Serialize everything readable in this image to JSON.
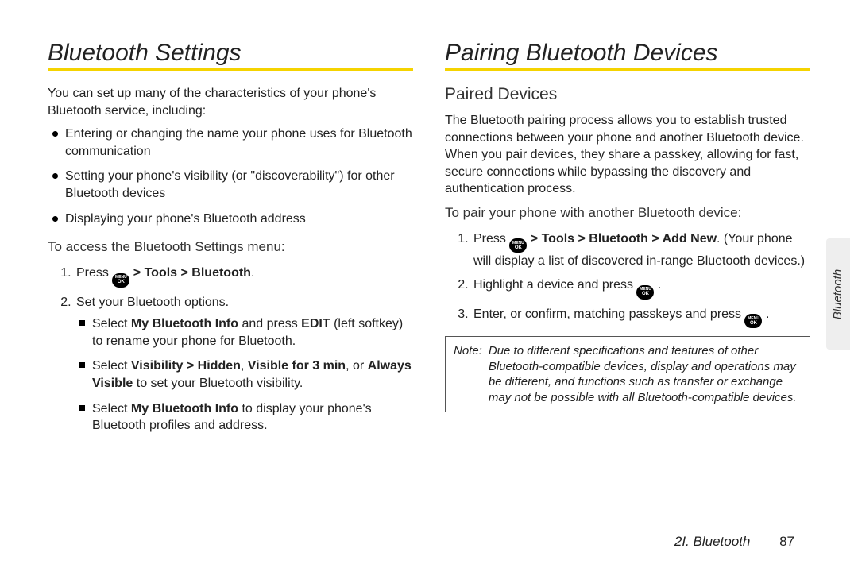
{
  "left": {
    "title": "Bluetooth Settings",
    "intro": "You can set up many of the characteristics of your phone's Bluetooth service, including:",
    "bullets": [
      "Entering or changing the name your phone uses for Bluetooth communication",
      "Setting your phone's visibility (or \"discoverability\") for other Bluetooth devices",
      "Displaying your phone's Bluetooth address"
    ],
    "access_heading": "To access the Bluetooth Settings menu:",
    "step1_prefix": "Press ",
    "step1_path": " > Tools > Bluetooth",
    "step1_end": ".",
    "step2": "Set your Bluetooth options.",
    "sq1_a": "Select ",
    "sq1_b": "My Bluetooth Info",
    "sq1_c": " and press ",
    "sq1_d": "EDIT",
    "sq1_e": " (left softkey) to rename your phone for Bluetooth.",
    "sq2_a": "Select ",
    "sq2_b": "Visibility > Hidden",
    "sq2_c": ", ",
    "sq2_d": "Visible for 3 min",
    "sq2_e": ", or ",
    "sq2_f": "Always Visible",
    "sq2_g": " to set your Bluetooth visibility.",
    "sq3_a": "Select ",
    "sq3_b": "My Bluetooth Info",
    "sq3_c": " to display your phone's Bluetooth profiles and address."
  },
  "right": {
    "title": "Pairing Bluetooth Devices",
    "section": "Paired Devices",
    "para": "The Bluetooth pairing process allows you to establish trusted connections between your phone and another Bluetooth device. When you pair devices, they share a passkey, allowing for fast, secure connections while bypassing the discovery and authentication process.",
    "pair_heading": "To pair your phone with another Bluetooth device:",
    "r1_a": "Press ",
    "r1_b": " > Tools > Bluetooth > Add New",
    "r1_c": ". (Your phone will display a list of discovered in-range Bluetooth devices.)",
    "r2_a": "Highlight a device and press ",
    "r2_b": ".",
    "r3_a": "Enter, or confirm, matching passkeys and press ",
    "r3_b": ".",
    "note_label": "Note:",
    "note_text": "Due to different specifications and features of other Bluetooth-compatible devices, display and operations may be different, and functions such as transfer or exchange may not be possible with all Bluetooth-compatible devices."
  },
  "key": {
    "top": "MENU",
    "bottom": "OK"
  },
  "tab": "Bluetooth",
  "footer_section": "2I. Bluetooth",
  "footer_page": "87"
}
